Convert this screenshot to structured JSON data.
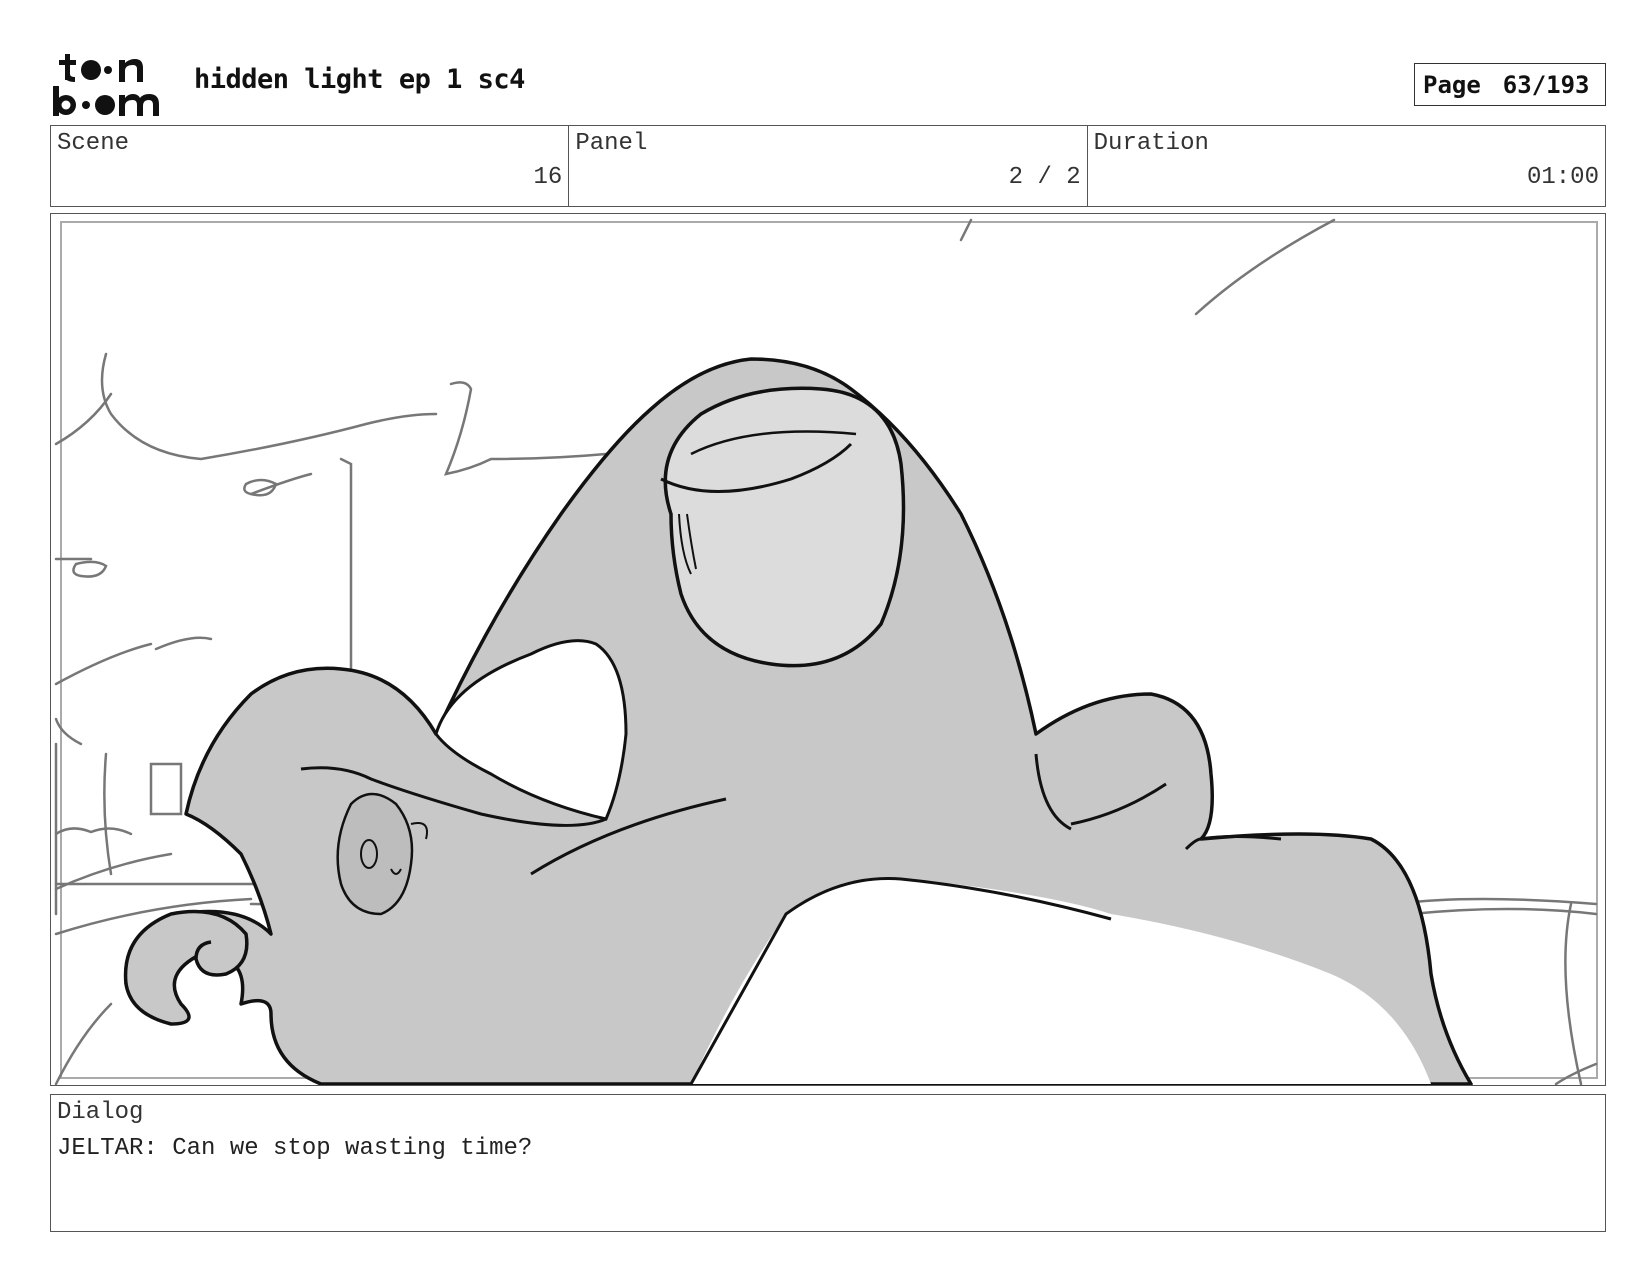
{
  "header": {
    "logo_text_top": "toon",
    "logo_text_bottom": "boom",
    "title": "hidden light ep 1 sc4",
    "page_label": "Page",
    "page_value": "63/193"
  },
  "info": {
    "scene_label": "Scene",
    "scene_value": "16",
    "panel_label": "Panel",
    "panel_value": "2 / 2",
    "duration_label": "Duration",
    "duration_value": "01:00"
  },
  "dialog": {
    "label": "Dialog",
    "text": "JELTAR: Can we stop wasting time?"
  }
}
